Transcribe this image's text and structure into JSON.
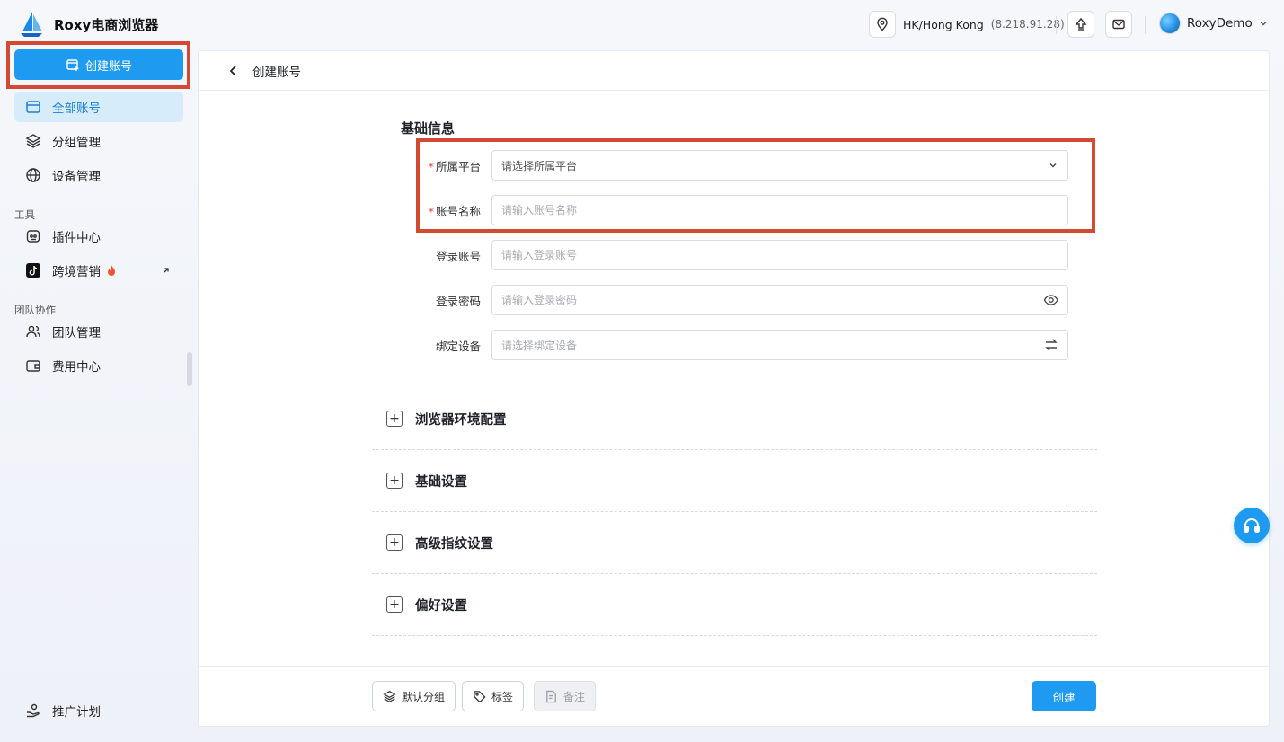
{
  "app": {
    "title": "Roxy电商浏览器"
  },
  "header": {
    "location": "HK/Hong Kong",
    "ip": "(8.218.91.28)",
    "user_name": "RoxyDemo"
  },
  "sidebar": {
    "create_label": "创建账号",
    "items": [
      {
        "label": "全部账号",
        "icon": "card-icon"
      },
      {
        "label": "分组管理",
        "icon": "layers-icon"
      },
      {
        "label": "设备管理",
        "icon": "globe-icon"
      }
    ],
    "tools_label": "工具",
    "tools": [
      {
        "label": "插件中心",
        "icon": "plugin-icon"
      },
      {
        "label": "跨境营销",
        "icon": "tiktok-icon"
      }
    ],
    "team_label": "团队协作",
    "team": [
      {
        "label": "团队管理",
        "icon": "users-icon"
      },
      {
        "label": "费用中心",
        "icon": "wallet-icon"
      }
    ],
    "promo_label": "推广计划"
  },
  "page": {
    "title": "创建账号",
    "section_title": "基础信息",
    "fields": {
      "platform": {
        "label": "所属平台",
        "placeholder": "请选择所属平台"
      },
      "account_name": {
        "label": "账号名称",
        "placeholder": "请输入账号名称"
      },
      "login_account": {
        "label": "登录账号",
        "placeholder": "请输入登录账号"
      },
      "login_password": {
        "label": "登录密码",
        "placeholder": "请输入登录密码"
      },
      "bind_device": {
        "label": "绑定设备",
        "placeholder": "请选择绑定设备"
      }
    },
    "required_mark": "*",
    "collapses": [
      "浏览器环境配置",
      "基础设置",
      "高级指纹设置",
      "偏好设置"
    ],
    "plus_symbol": "+",
    "footer": {
      "default_group": "默认分组",
      "tags": "标签",
      "note": "备注",
      "create": "创建"
    }
  },
  "colors": {
    "accent": "#1e9bf0",
    "annotation": "#d24a32",
    "active_bg": "#d7ecfb"
  }
}
